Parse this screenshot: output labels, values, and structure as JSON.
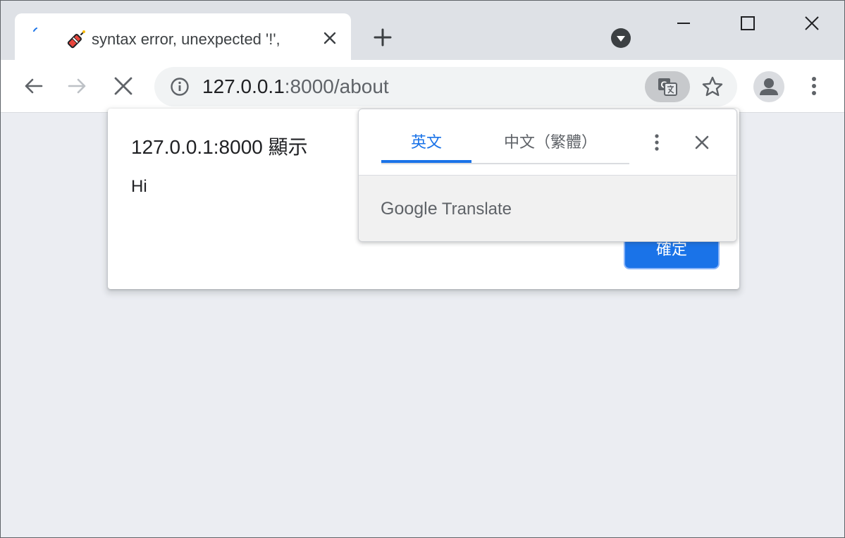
{
  "tab": {
    "title": "syntax error, unexpected '!', "
  },
  "omnibox": {
    "host": "127.0.0.1",
    "path": ":8000/about"
  },
  "dialog": {
    "title": "127.0.0.1:8000 顯示",
    "message": "Hi",
    "ok_label": "確定"
  },
  "translate": {
    "source_lang": "英文",
    "target_lang": "中文（繁體）",
    "brand_google": "Google",
    "brand_translate": "Translate"
  },
  "colors": {
    "accent": "#1a73e8",
    "tab_strip": "#dee1e6",
    "page_bg": "#ebedf2"
  },
  "icons": [
    "loading-spinner-icon",
    "firecracker-icon",
    "close-icon",
    "plus-icon",
    "tab-search-icon",
    "minimize-icon",
    "maximize-icon",
    "back-arrow-icon",
    "forward-arrow-icon",
    "stop-icon",
    "info-icon",
    "translate-icon",
    "star-icon",
    "profile-icon",
    "more-vert-icon"
  ]
}
